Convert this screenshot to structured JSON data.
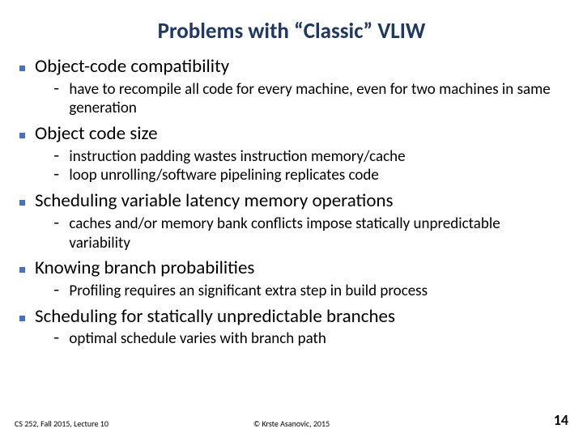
{
  "title": "Problems with “Classic” VLIW",
  "bullets": [
    {
      "text": "Object-code compatibility",
      "subs": [
        "have to recompile all code for every machine, even for two machines in same generation"
      ]
    },
    {
      "text": "Object code size",
      "subs": [
        "instruction padding wastes instruction memory/cache",
        "loop unrolling/software pipelining replicates code"
      ]
    },
    {
      "text": "Scheduling variable latency memory operations",
      "subs": [
        "caches and/or memory bank conflicts impose statically unpredictable variability"
      ]
    },
    {
      "text": "Knowing branch probabilities",
      "subs": [
        "Profiling requires an significant extra step in build process"
      ]
    },
    {
      "text": "Scheduling for statically unpredictable branches",
      "subs": [
        "optimal schedule varies with branch path"
      ]
    }
  ],
  "footer": {
    "left": "CS 252, Fall 2015, Lecture 10",
    "center": "© Krste Asanovic, 2015",
    "page": "14"
  }
}
